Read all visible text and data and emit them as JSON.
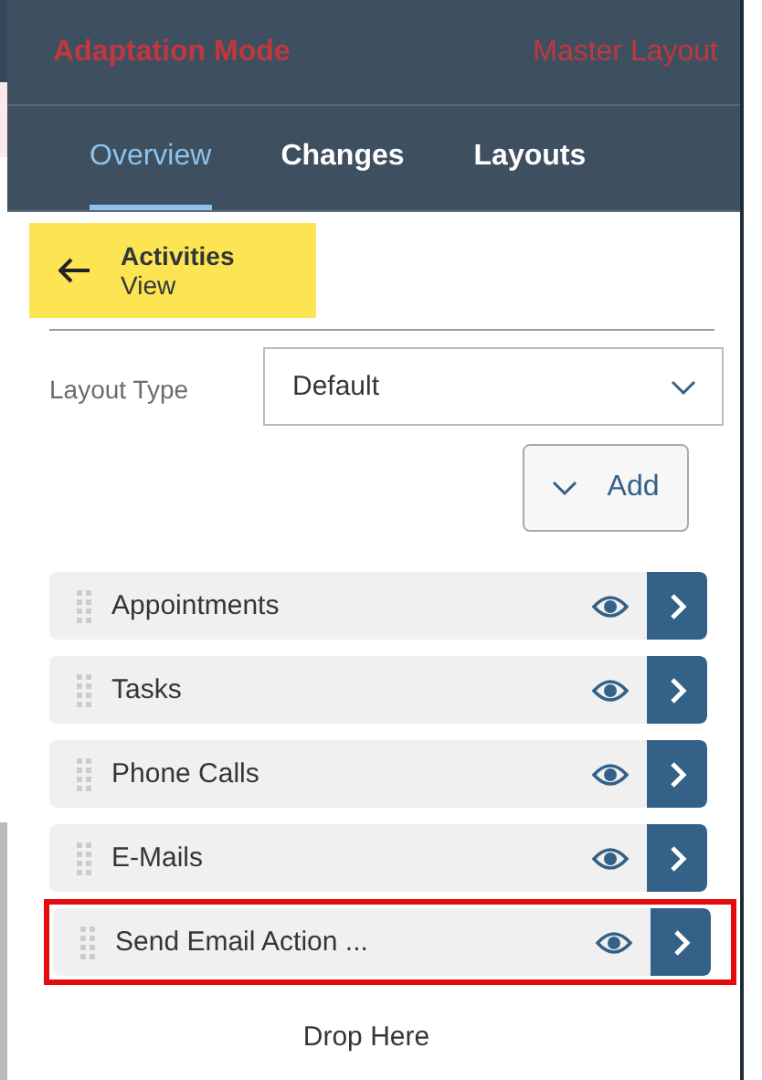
{
  "header": {
    "title": "Adaptation Mode",
    "layout": "Master Layout"
  },
  "tabs": [
    {
      "label": "Overview",
      "selected": true
    },
    {
      "label": "Changes",
      "selected": false
    },
    {
      "label": "Layouts",
      "selected": false
    }
  ],
  "section": {
    "title": "Activities",
    "subtitle": "View",
    "highlighted": true
  },
  "layout_type": {
    "label": "Layout Type",
    "value": "Default"
  },
  "add_button": "Add",
  "items": [
    {
      "label": "Appointments",
      "visible": true,
      "highlighted": false
    },
    {
      "label": "Tasks",
      "visible": true,
      "highlighted": false
    },
    {
      "label": "Phone Calls",
      "visible": true,
      "highlighted": false
    },
    {
      "label": "E-Mails",
      "visible": true,
      "highlighted": false
    },
    {
      "label": "Send Email Action ...",
      "visible": true,
      "highlighted": true
    }
  ],
  "drop_zone": "Drop Here"
}
